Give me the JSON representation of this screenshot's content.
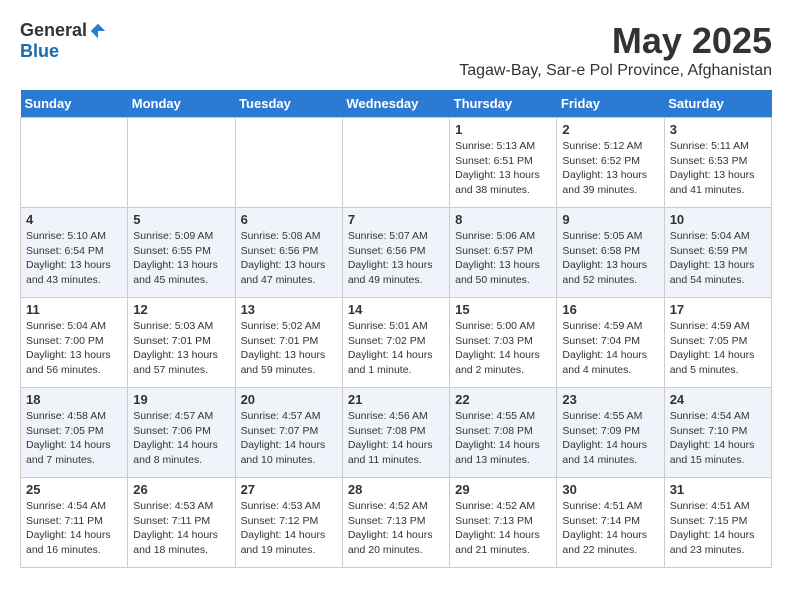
{
  "header": {
    "logo_general": "General",
    "logo_blue": "Blue",
    "month_title": "May 2025",
    "location": "Tagaw-Bay, Sar-e Pol Province, Afghanistan"
  },
  "weekdays": [
    "Sunday",
    "Monday",
    "Tuesday",
    "Wednesday",
    "Thursday",
    "Friday",
    "Saturday"
  ],
  "weeks": [
    [
      {
        "day": "",
        "sunrise": "",
        "sunset": "",
        "daylight": ""
      },
      {
        "day": "",
        "sunrise": "",
        "sunset": "",
        "daylight": ""
      },
      {
        "day": "",
        "sunrise": "",
        "sunset": "",
        "daylight": ""
      },
      {
        "day": "",
        "sunrise": "",
        "sunset": "",
        "daylight": ""
      },
      {
        "day": "1",
        "sunrise": "Sunrise: 5:13 AM",
        "sunset": "Sunset: 6:51 PM",
        "daylight": "Daylight: 13 hours and 38 minutes."
      },
      {
        "day": "2",
        "sunrise": "Sunrise: 5:12 AM",
        "sunset": "Sunset: 6:52 PM",
        "daylight": "Daylight: 13 hours and 39 minutes."
      },
      {
        "day": "3",
        "sunrise": "Sunrise: 5:11 AM",
        "sunset": "Sunset: 6:53 PM",
        "daylight": "Daylight: 13 hours and 41 minutes."
      }
    ],
    [
      {
        "day": "4",
        "sunrise": "Sunrise: 5:10 AM",
        "sunset": "Sunset: 6:54 PM",
        "daylight": "Daylight: 13 hours and 43 minutes."
      },
      {
        "day": "5",
        "sunrise": "Sunrise: 5:09 AM",
        "sunset": "Sunset: 6:55 PM",
        "daylight": "Daylight: 13 hours and 45 minutes."
      },
      {
        "day": "6",
        "sunrise": "Sunrise: 5:08 AM",
        "sunset": "Sunset: 6:56 PM",
        "daylight": "Daylight: 13 hours and 47 minutes."
      },
      {
        "day": "7",
        "sunrise": "Sunrise: 5:07 AM",
        "sunset": "Sunset: 6:56 PM",
        "daylight": "Daylight: 13 hours and 49 minutes."
      },
      {
        "day": "8",
        "sunrise": "Sunrise: 5:06 AM",
        "sunset": "Sunset: 6:57 PM",
        "daylight": "Daylight: 13 hours and 50 minutes."
      },
      {
        "day": "9",
        "sunrise": "Sunrise: 5:05 AM",
        "sunset": "Sunset: 6:58 PM",
        "daylight": "Daylight: 13 hours and 52 minutes."
      },
      {
        "day": "10",
        "sunrise": "Sunrise: 5:04 AM",
        "sunset": "Sunset: 6:59 PM",
        "daylight": "Daylight: 13 hours and 54 minutes."
      }
    ],
    [
      {
        "day": "11",
        "sunrise": "Sunrise: 5:04 AM",
        "sunset": "Sunset: 7:00 PM",
        "daylight": "Daylight: 13 hours and 56 minutes."
      },
      {
        "day": "12",
        "sunrise": "Sunrise: 5:03 AM",
        "sunset": "Sunset: 7:01 PM",
        "daylight": "Daylight: 13 hours and 57 minutes."
      },
      {
        "day": "13",
        "sunrise": "Sunrise: 5:02 AM",
        "sunset": "Sunset: 7:01 PM",
        "daylight": "Daylight: 13 hours and 59 minutes."
      },
      {
        "day": "14",
        "sunrise": "Sunrise: 5:01 AM",
        "sunset": "Sunset: 7:02 PM",
        "daylight": "Daylight: 14 hours and 1 minute."
      },
      {
        "day": "15",
        "sunrise": "Sunrise: 5:00 AM",
        "sunset": "Sunset: 7:03 PM",
        "daylight": "Daylight: 14 hours and 2 minutes."
      },
      {
        "day": "16",
        "sunrise": "Sunrise: 4:59 AM",
        "sunset": "Sunset: 7:04 PM",
        "daylight": "Daylight: 14 hours and 4 minutes."
      },
      {
        "day": "17",
        "sunrise": "Sunrise: 4:59 AM",
        "sunset": "Sunset: 7:05 PM",
        "daylight": "Daylight: 14 hours and 5 minutes."
      }
    ],
    [
      {
        "day": "18",
        "sunrise": "Sunrise: 4:58 AM",
        "sunset": "Sunset: 7:05 PM",
        "daylight": "Daylight: 14 hours and 7 minutes."
      },
      {
        "day": "19",
        "sunrise": "Sunrise: 4:57 AM",
        "sunset": "Sunset: 7:06 PM",
        "daylight": "Daylight: 14 hours and 8 minutes."
      },
      {
        "day": "20",
        "sunrise": "Sunrise: 4:57 AM",
        "sunset": "Sunset: 7:07 PM",
        "daylight": "Daylight: 14 hours and 10 minutes."
      },
      {
        "day": "21",
        "sunrise": "Sunrise: 4:56 AM",
        "sunset": "Sunset: 7:08 PM",
        "daylight": "Daylight: 14 hours and 11 minutes."
      },
      {
        "day": "22",
        "sunrise": "Sunrise: 4:55 AM",
        "sunset": "Sunset: 7:08 PM",
        "daylight": "Daylight: 14 hours and 13 minutes."
      },
      {
        "day": "23",
        "sunrise": "Sunrise: 4:55 AM",
        "sunset": "Sunset: 7:09 PM",
        "daylight": "Daylight: 14 hours and 14 minutes."
      },
      {
        "day": "24",
        "sunrise": "Sunrise: 4:54 AM",
        "sunset": "Sunset: 7:10 PM",
        "daylight": "Daylight: 14 hours and 15 minutes."
      }
    ],
    [
      {
        "day": "25",
        "sunrise": "Sunrise: 4:54 AM",
        "sunset": "Sunset: 7:11 PM",
        "daylight": "Daylight: 14 hours and 16 minutes."
      },
      {
        "day": "26",
        "sunrise": "Sunrise: 4:53 AM",
        "sunset": "Sunset: 7:11 PM",
        "daylight": "Daylight: 14 hours and 18 minutes."
      },
      {
        "day": "27",
        "sunrise": "Sunrise: 4:53 AM",
        "sunset": "Sunset: 7:12 PM",
        "daylight": "Daylight: 14 hours and 19 minutes."
      },
      {
        "day": "28",
        "sunrise": "Sunrise: 4:52 AM",
        "sunset": "Sunset: 7:13 PM",
        "daylight": "Daylight: 14 hours and 20 minutes."
      },
      {
        "day": "29",
        "sunrise": "Sunrise: 4:52 AM",
        "sunset": "Sunset: 7:13 PM",
        "daylight": "Daylight: 14 hours and 21 minutes."
      },
      {
        "day": "30",
        "sunrise": "Sunrise: 4:51 AM",
        "sunset": "Sunset: 7:14 PM",
        "daylight": "Daylight: 14 hours and 22 minutes."
      },
      {
        "day": "31",
        "sunrise": "Sunrise: 4:51 AM",
        "sunset": "Sunset: 7:15 PM",
        "daylight": "Daylight: 14 hours and 23 minutes."
      }
    ]
  ]
}
